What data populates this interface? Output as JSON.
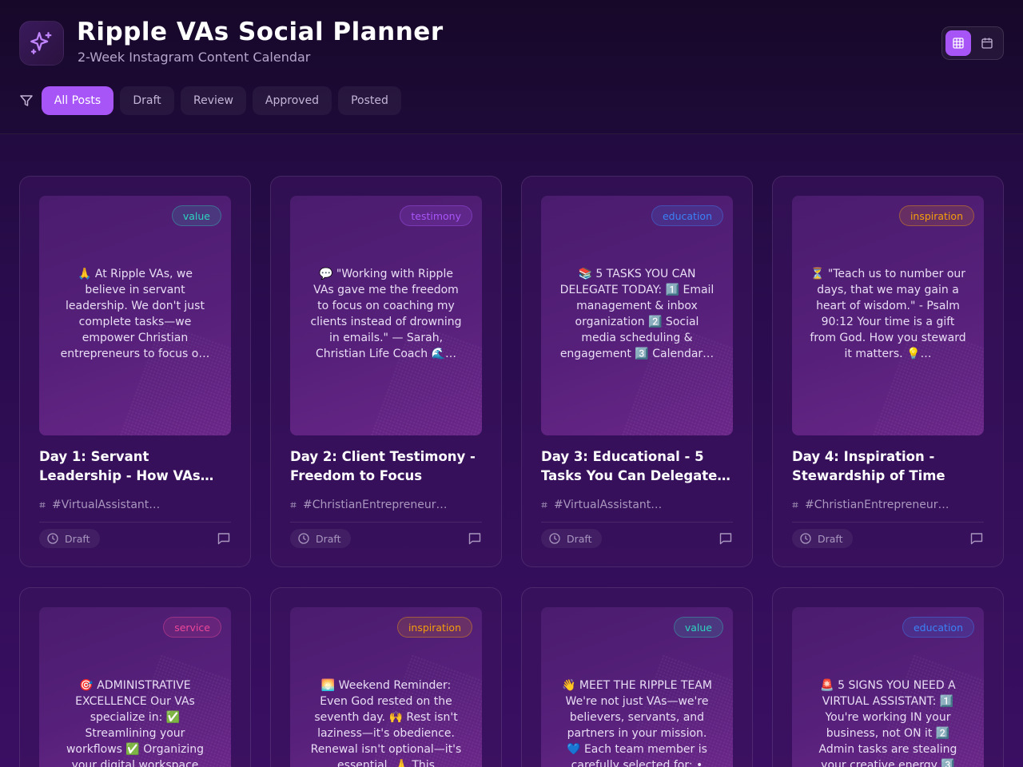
{
  "app": {
    "title": "Ripple VAs Social Planner",
    "subtitle": "2-Week Instagram Content Calendar",
    "logo_icon": "sparkles-icon"
  },
  "view_toggle": {
    "options": [
      {
        "name": "grid-view",
        "icon": "grid-icon",
        "active": true
      },
      {
        "name": "calendar-view",
        "icon": "calendar-icon",
        "active": false
      }
    ]
  },
  "filters": {
    "icon": "filter-icon",
    "tabs": [
      {
        "label": "All Posts",
        "active": true
      },
      {
        "label": "Draft",
        "active": false
      },
      {
        "label": "Review",
        "active": false
      },
      {
        "label": "Approved",
        "active": false
      },
      {
        "label": "Posted",
        "active": false
      }
    ]
  },
  "colors": {
    "accent": "#a855f7",
    "value": "#2dd4bf",
    "testimony": "#a855f7",
    "education": "#3b82f6",
    "inspiration": "#f59e0b",
    "service": "#ec4899"
  },
  "posts": [
    {
      "category": "value",
      "preview": "🙏 At Ripple VAs, we believe in servant leadership. We don't just complete tasks—we empower Christian entrepreneurs to focus o…",
      "title": "Day 1: Servant Leadership - How VAs Empower…",
      "hashtags": "#VirtualAssistant…",
      "status": "Draft"
    },
    {
      "category": "testimony",
      "preview": "💬 \"Working with Ripple VAs gave me the freedom to focus on coaching my clients instead of drowning in emails.\" — Sarah, Christian Life Coach 🌊…",
      "title": "Day 2: Client Testimony - Freedom to Focus",
      "hashtags": "#ChristianEntrepreneur…",
      "status": "Draft"
    },
    {
      "category": "education",
      "preview": "📚 5 TASKS YOU CAN DELEGATE TODAY: 1️⃣ Email management & inbox organization 2️⃣ Social media scheduling & engagement 3️⃣ Calendar…",
      "title": "Day 3: Educational - 5 Tasks You Can Delegate…",
      "hashtags": "#VirtualAssistant…",
      "status": "Draft"
    },
    {
      "category": "inspiration",
      "preview": "⏳ \"Teach us to number our days, that we may gain a heart of wisdom.\" - Psalm 90:12 Your time is a gift from God. How you steward it matters. 💡…",
      "title": "Day 4: Inspiration - Stewardship of Time",
      "hashtags": "#ChristianEntrepreneur…",
      "status": "Draft"
    },
    {
      "category": "service",
      "preview": "🎯 ADMINISTRATIVE EXCELLENCE Our VAs specialize in: ✅ Streamlining your workflows ✅ Organizing your digital workspace",
      "title": "",
      "hashtags": "",
      "status": ""
    },
    {
      "category": "inspiration",
      "preview": "🌅 Weekend Reminder: Even God rested on the seventh day. 🙌 Rest isn't laziness—it's obedience. Renewal isn't optional—it's essential. 🙏 This",
      "title": "",
      "hashtags": "",
      "status": ""
    },
    {
      "category": "value",
      "preview": "👋 MEET THE RIPPLE TEAM We're not just VAs—we're believers, servants, and partners in your mission. 💙 Each team member is carefully selected for: •",
      "title": "",
      "hashtags": "",
      "status": ""
    },
    {
      "category": "education",
      "preview": "🚨 5 SIGNS YOU NEED A VIRTUAL ASSISTANT: 1️⃣ You're working IN your business, not ON it 2️⃣ Admin tasks are stealing your creative energy 3️⃣",
      "title": "",
      "hashtags": "",
      "status": ""
    }
  ]
}
